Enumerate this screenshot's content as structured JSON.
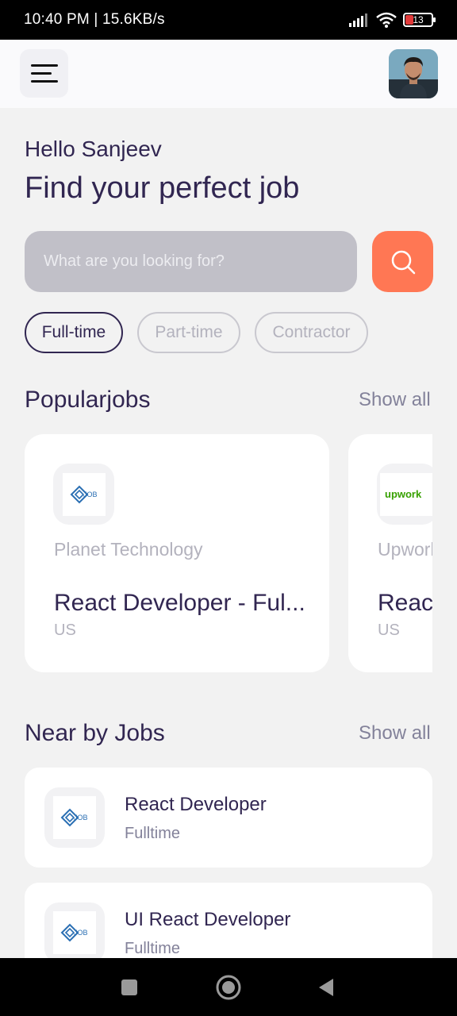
{
  "status_bar": {
    "time_text": "10:40 PM | 15.6KB/s",
    "battery": "13"
  },
  "header": {
    "menu_icon": "menu-icon",
    "avatar": "profile-avatar"
  },
  "greeting": "Hello Sanjeev",
  "headline": "Find your perfect job",
  "search": {
    "placeholder": "What are you looking for?",
    "button_icon": "search-icon"
  },
  "job_types": [
    {
      "label": "Full-time",
      "active": true
    },
    {
      "label": "Part-time",
      "active": false
    },
    {
      "label": "Contractor",
      "active": false
    }
  ],
  "popular": {
    "title": "Popularjobs",
    "show_all": "Show all",
    "jobs": [
      {
        "company": "Planet Technology",
        "title": "React Developer - Ful...",
        "location": "US",
        "logo": "JOB"
      },
      {
        "company": "Upwork",
        "title": "React",
        "location": "US",
        "logo": "upwork"
      }
    ]
  },
  "nearby": {
    "title": "Near by Jobs",
    "show_all": "Show all",
    "jobs": [
      {
        "title": "React Developer",
        "type": "Fulltime",
        "logo": "JOB"
      },
      {
        "title": "UI React Developer",
        "type": "Fulltime",
        "logo": "JOB"
      }
    ]
  },
  "colors": {
    "accent": "#ff7754",
    "primary": "#312651",
    "muted": "#b3b2bd"
  }
}
